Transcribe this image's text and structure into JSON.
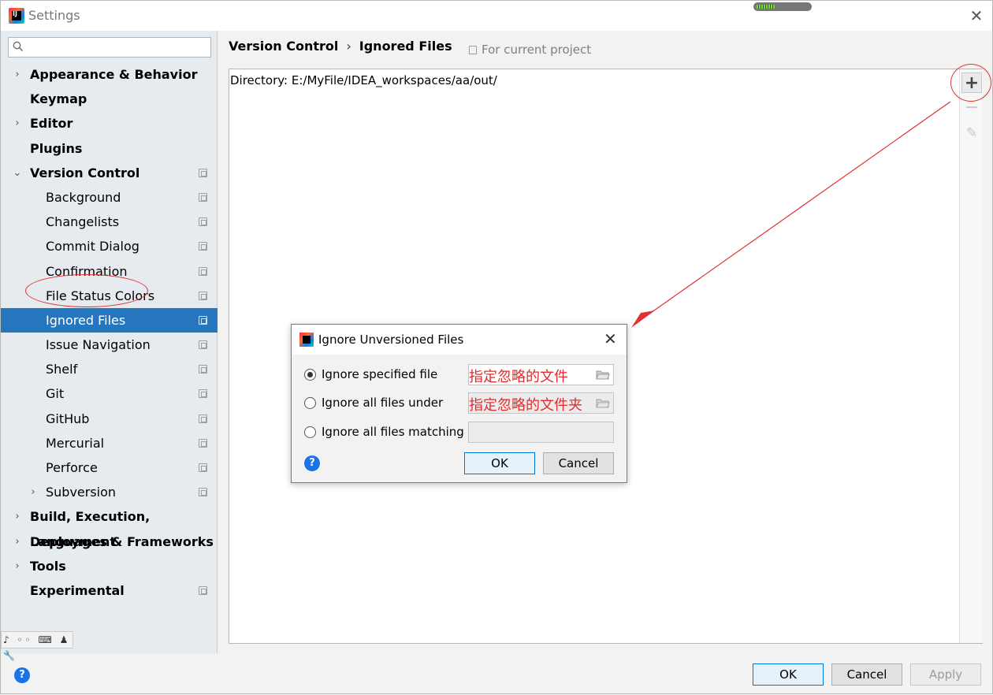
{
  "window": {
    "title": "Settings",
    "progress_fraction": 0.35
  },
  "search": {
    "placeholder": ""
  },
  "sidebar": {
    "items": [
      {
        "label": "Appearance & Behavior",
        "level": 0,
        "expand": "collapsed",
        "copy": false,
        "selected": false
      },
      {
        "label": "Keymap",
        "level": 0,
        "expand": "none",
        "copy": false,
        "selected": false
      },
      {
        "label": "Editor",
        "level": 0,
        "expand": "collapsed",
        "copy": false,
        "selected": false
      },
      {
        "label": "Plugins",
        "level": 0,
        "expand": "none",
        "copy": false,
        "selected": false
      },
      {
        "label": "Version Control",
        "level": 0,
        "expand": "expanded",
        "copy": true,
        "selected": false
      },
      {
        "label": "Background",
        "level": 1,
        "expand": "none",
        "copy": true,
        "selected": false
      },
      {
        "label": "Changelists",
        "level": 1,
        "expand": "none",
        "copy": true,
        "selected": false
      },
      {
        "label": "Commit Dialog",
        "level": 1,
        "expand": "none",
        "copy": true,
        "selected": false
      },
      {
        "label": "Confirmation",
        "level": 1,
        "expand": "none",
        "copy": true,
        "selected": false
      },
      {
        "label": "File Status Colors",
        "level": 1,
        "expand": "none",
        "copy": true,
        "selected": false
      },
      {
        "label": "Ignored Files",
        "level": 1,
        "expand": "none",
        "copy": true,
        "selected": true
      },
      {
        "label": "Issue Navigation",
        "level": 1,
        "expand": "none",
        "copy": true,
        "selected": false
      },
      {
        "label": "Shelf",
        "level": 1,
        "expand": "none",
        "copy": true,
        "selected": false
      },
      {
        "label": "Git",
        "level": 1,
        "expand": "none",
        "copy": true,
        "selected": false
      },
      {
        "label": "GitHub",
        "level": 1,
        "expand": "none",
        "copy": true,
        "selected": false
      },
      {
        "label": "Mercurial",
        "level": 1,
        "expand": "none",
        "copy": true,
        "selected": false
      },
      {
        "label": "Perforce",
        "level": 1,
        "expand": "none",
        "copy": true,
        "selected": false
      },
      {
        "label": "Subversion",
        "level": 1,
        "expand": "collapsed",
        "copy": true,
        "selected": false
      },
      {
        "label": "Build, Execution, Deployment",
        "level": 0,
        "expand": "collapsed",
        "copy": false,
        "selected": false
      },
      {
        "label": "Languages & Frameworks",
        "level": 0,
        "expand": "collapsed",
        "copy": false,
        "selected": false
      },
      {
        "label": "Tools",
        "level": 0,
        "expand": "collapsed",
        "copy": false,
        "selected": false
      },
      {
        "label": "Experimental",
        "level": 0,
        "expand": "none",
        "copy": true,
        "selected": false
      }
    ],
    "bottom_tools": "♪ ◦◦ ⌨ ♟ 🔧"
  },
  "breadcrumb": {
    "parent": "Version Control",
    "separator": "›",
    "current": "Ignored Files"
  },
  "scope_label": "For current project",
  "ignored_list": {
    "entries": [
      "Directory: E:/MyFile/IDEA_workspaces/aa/out/"
    ]
  },
  "toolbar": {
    "add": "+",
    "remove": "−",
    "edit": "✎"
  },
  "dialog": {
    "title": "Ignore Unversioned Files",
    "close": "✕",
    "options": [
      {
        "label": "Ignore specified file",
        "checked": true,
        "field_value": "指定忽略的文件",
        "has_browse": true,
        "disabled": false
      },
      {
        "label": "Ignore all files under",
        "checked": false,
        "field_value": "指定忽略的文件夹",
        "has_browse": true,
        "disabled": true
      },
      {
        "label": "Ignore all files matching",
        "checked": false,
        "field_value": "",
        "has_browse": false,
        "disabled": true
      }
    ],
    "help": "?",
    "ok": "OK",
    "cancel": "Cancel"
  },
  "footer": {
    "help": "?",
    "ok": "OK",
    "cancel": "Cancel",
    "apply": "Apply"
  },
  "colors": {
    "selection": "#2675bf",
    "annotation": "#e03030",
    "sidebar_bg": "#e6ebf0"
  }
}
